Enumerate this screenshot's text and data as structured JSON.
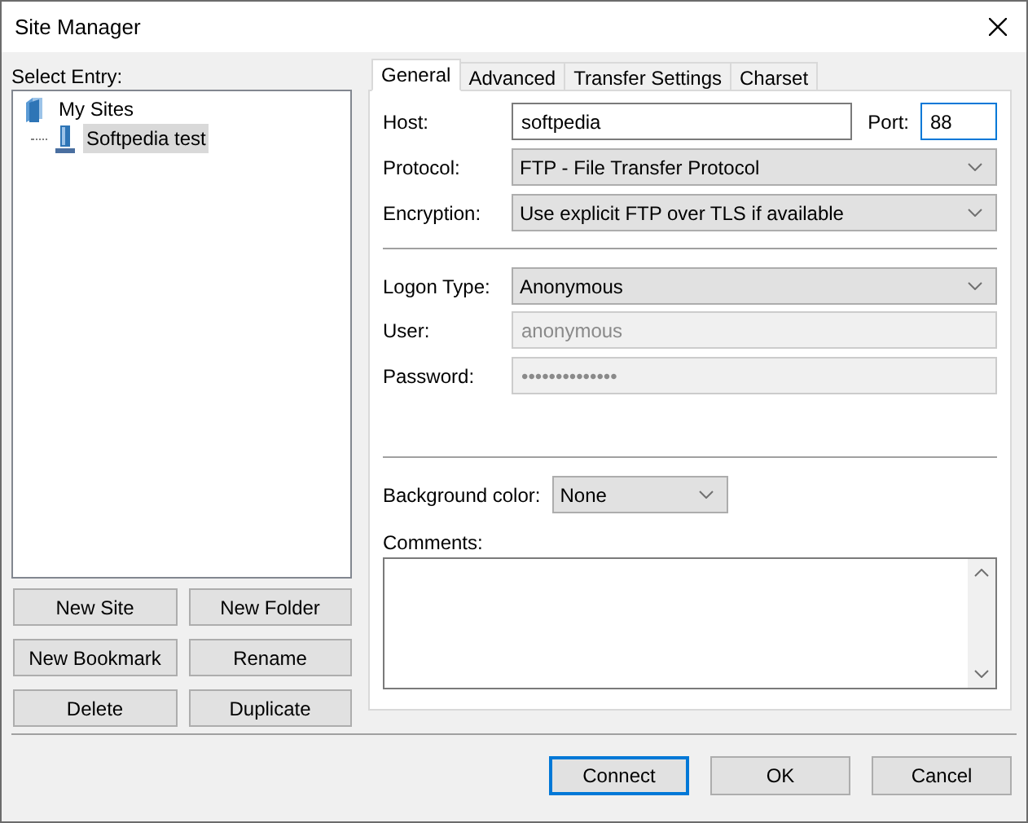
{
  "window": {
    "title": "Site Manager"
  },
  "select_entry_label": "Select Entry:",
  "tree": [
    {
      "label": "My Sites",
      "kind": "folder",
      "selected": false,
      "children": [
        {
          "label": "Softpedia test",
          "kind": "site",
          "selected": true
        }
      ]
    }
  ],
  "site_buttons": [
    "New Site",
    "New Folder",
    "New Bookmark",
    "Rename",
    "Delete",
    "Duplicate"
  ],
  "tabs": [
    {
      "label": "General",
      "selected": true
    },
    {
      "label": "Advanced",
      "selected": false
    },
    {
      "label": "Transfer Settings",
      "selected": false
    },
    {
      "label": "Charset",
      "selected": false
    }
  ],
  "general": {
    "host": {
      "label": "Host:",
      "value": "softpedia"
    },
    "port": {
      "label": "Port:",
      "value": "88",
      "focused": true
    },
    "protocol": {
      "label": "Protocol:",
      "value": "FTP - File Transfer Protocol"
    },
    "encryption": {
      "label": "Encryption:",
      "value": "Use explicit FTP over TLS if available"
    },
    "logon_type": {
      "label": "Logon Type:",
      "value": "Anonymous"
    },
    "user": {
      "label": "User:",
      "value": "anonymous",
      "disabled": true
    },
    "password": {
      "label": "Password:",
      "value": "••••••••••••••",
      "disabled": true
    },
    "background_color": {
      "label": "Background color:",
      "value": "None"
    },
    "comments": {
      "label": "Comments:"
    }
  },
  "dialog_buttons": [
    {
      "label": "Connect",
      "default": true
    },
    {
      "label": "OK",
      "default": false
    },
    {
      "label": "Cancel",
      "default": false
    }
  ]
}
